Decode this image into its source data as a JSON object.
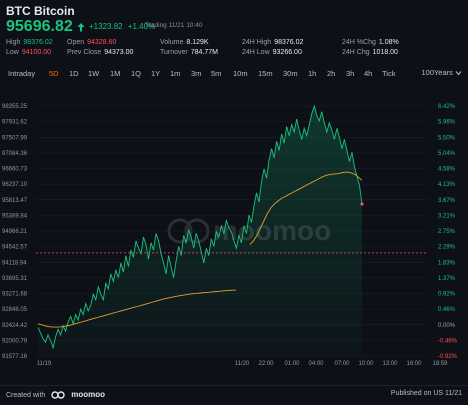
{
  "header": {
    "title": "BTC Bitcoin",
    "price": "95696.82",
    "change_abs": "+1323.82",
    "change_pct": "+1.40%",
    "trading_time": "Trading 11/21 10:40"
  },
  "stats": [
    {
      "label": "High",
      "value": "98376.02",
      "tone": "up"
    },
    {
      "label": "Open",
      "value": "94328.60",
      "tone": "down"
    },
    {
      "label": "Volume",
      "value": "8.129K",
      "tone": "neutral"
    },
    {
      "label": "24H High",
      "value": "98376.02",
      "tone": "neutral"
    },
    {
      "label": "24H %Chg",
      "value": "1.08%",
      "tone": "neutral"
    },
    {
      "label": "Low",
      "value": "94100.00",
      "tone": "down"
    },
    {
      "label": "Prev Close",
      "value": "94373.00",
      "tone": "neutral"
    },
    {
      "label": "Turnover",
      "value": "784.77M",
      "tone": "neutral"
    },
    {
      "label": "24H Low",
      "value": "93266.00",
      "tone": "neutral"
    },
    {
      "label": "24H Chg",
      "value": "1018.00",
      "tone": "neutral"
    }
  ],
  "tabs": [
    {
      "label": "Intraday",
      "active": false
    },
    {
      "label": "5D",
      "active": true
    },
    {
      "label": "1D",
      "active": false
    },
    {
      "label": "1W",
      "active": false
    },
    {
      "label": "1M",
      "active": false
    },
    {
      "label": "1Q",
      "active": false
    },
    {
      "label": "1Y",
      "active": false
    },
    {
      "label": "1m",
      "active": false
    },
    {
      "label": "3m",
      "active": false
    },
    {
      "label": "5m",
      "active": false
    },
    {
      "label": "10m",
      "active": false
    },
    {
      "label": "15m",
      "active": false
    },
    {
      "label": "30m",
      "active": false
    },
    {
      "label": "1h",
      "active": false
    },
    {
      "label": "2h",
      "active": false
    },
    {
      "label": "3h",
      "active": false
    },
    {
      "label": "4h",
      "active": false
    },
    {
      "label": "Tick",
      "active": false
    }
  ],
  "range_selector": "100Years",
  "chart_data": {
    "type": "line",
    "prev_close": 94373.0,
    "y_ticks": [
      "98355.25",
      "97931.62",
      "97507.99",
      "97084.36",
      "96660.73",
      "96237.10",
      "95813.47",
      "95389.84",
      "94966.21",
      "94542.57",
      "94118.94",
      "93695.31",
      "93271.68",
      "92848.05",
      "92424.42",
      "92000.79",
      "91577.16"
    ],
    "pct_ticks": [
      "6.42%",
      "5.96%",
      "5.50%",
      "5.04%",
      "4.58%",
      "4.13%",
      "3.67%",
      "3.21%",
      "2.75%",
      "2.29%",
      "1.83%",
      "1.37%",
      "0.92%",
      "0.46%",
      "0.00%",
      "-0.46%",
      "-0.92%"
    ],
    "x_ticks": [
      "11/19",
      "11/20",
      "22:00",
      "01:00",
      "04:00",
      "07:00",
      "10:00",
      "13:00",
      "16:00",
      "18:59"
    ],
    "price_series": [
      92350,
      92200,
      92050,
      91950,
      92150,
      92000,
      91800,
      92100,
      92300,
      92150,
      92400,
      92250,
      92500,
      92650,
      92450,
      92700,
      92550,
      92850,
      92700,
      93000,
      92800,
      92950,
      93250,
      93100,
      93450,
      93250,
      93100,
      93550,
      93400,
      93800,
      93600,
      93900,
      93700,
      94100,
      93850,
      94300,
      94000,
      94450,
      94250,
      94700,
      94500,
      94350,
      94800,
      94600,
      94200,
      94650,
      94450,
      94900,
      94700,
      94350,
      94100,
      93800,
      94300,
      94000,
      93700,
      94150,
      94550,
      94300,
      94850,
      94650,
      95000,
      94800,
      94500,
      94900,
      94700,
      94400,
      94100,
      94500,
      94300,
      94750,
      94550,
      94950,
      94800,
      95100,
      94900,
      95250,
      95050,
      94950,
      94700,
      94500,
      94850,
      94650,
      95100,
      94900,
      95400,
      95200,
      95650,
      96000,
      95750,
      96300,
      96650,
      96400,
      96900,
      97200,
      96950,
      97400,
      97150,
      97600,
      97350,
      97800,
      97550,
      97850,
      97650,
      98000,
      97700,
      97450,
      97750,
      97550,
      97850,
      98150,
      98350,
      98100,
      97950,
      98200,
      97900,
      97650,
      97900,
      97700,
      97450,
      97750,
      97500,
      97200,
      97450,
      97150,
      96850,
      97100,
      96700,
      96450,
      96200,
      95697
    ],
    "avg_series": [
      92450,
      92420,
      92390,
      92370,
      92360,
      92360,
      92370,
      92390,
      92410,
      92440,
      92470,
      92500,
      92530,
      92560,
      92590,
      92620,
      92650,
      92680,
      92710,
      92740,
      92770,
      92800,
      92830,
      92860,
      92890,
      92920,
      92950,
      92980,
      93010,
      93040,
      93070,
      93100,
      93130,
      93155,
      93175,
      93195,
      93215,
      93235,
      93250,
      93265,
      93275,
      93285,
      93295,
      93305,
      93315,
      93325,
      93335,
      93345,
      93355,
      93360,
      93365
    ],
    "avg_series_2": [
      94600,
      94700,
      94850,
      95050,
      95250,
      95450,
      95600,
      95700,
      95780,
      95850,
      95900,
      95950,
      96000,
      96050,
      96100,
      96150,
      96200,
      96250,
      96300,
      96350,
      96400,
      96450,
      96480,
      96500,
      96510,
      96520,
      96540,
      96560,
      96560,
      96540,
      96500,
      96420,
      96340
    ],
    "ylim": [
      91577.16,
      98355.25
    ]
  },
  "footer": {
    "created_with": "Created with",
    "brand": "moomoo",
    "published": "Published on US 11/21"
  },
  "colors": {
    "up": "#19c37d",
    "down": "#ff4d5a",
    "avg_line": "#e0a030",
    "prev_close_line": "#ff4d5a",
    "active_tab": "#ff6a00"
  }
}
